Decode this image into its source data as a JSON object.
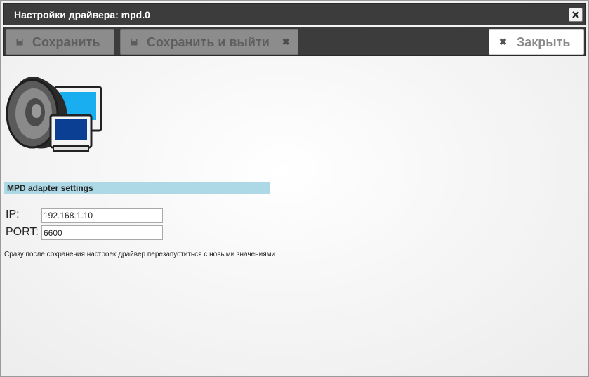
{
  "window": {
    "title": "Настройки драйвера: mpd.0"
  },
  "toolbar": {
    "save_label": "Сохранить",
    "save_exit_label": "Сохранить и выйти",
    "close_label": "Закрыть"
  },
  "section": {
    "title": "MPD adapter settings"
  },
  "form": {
    "ip_label": "IP:",
    "ip_value": "192.168.1.10",
    "port_label": "PORT:",
    "port_value": "6600"
  },
  "note": "Сразу после сохранения настроек драйвер перезапуститься с новыми значениями",
  "colors": {
    "titlebar": "#3c3c3c",
    "section_header": "#add8e6",
    "disabled_button": "#8c8c8c"
  }
}
